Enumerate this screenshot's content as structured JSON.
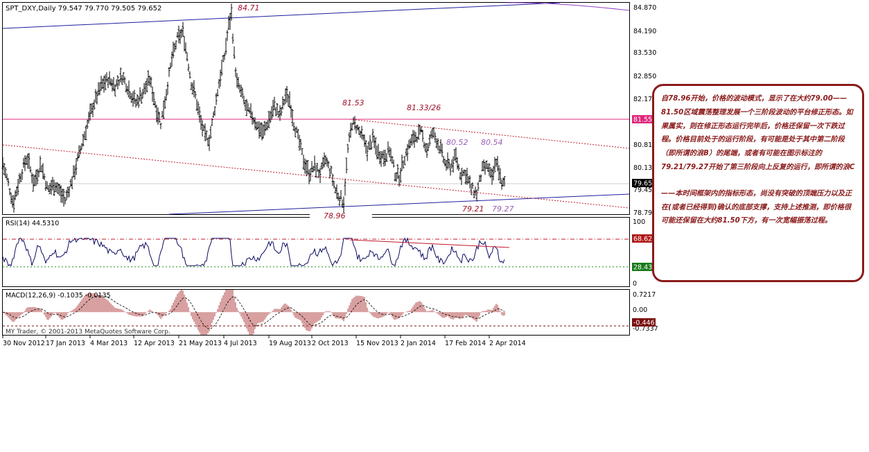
{
  "colors": {
    "background": "#ffffff",
    "frame": "#000000",
    "price_bars": "#000000",
    "channel_line": "#1e1ea0",
    "resistance_line": "#e0287c",
    "dotted_trend": "#c0182a",
    "overbought_line": "#c0182a",
    "oversold_line": "#1a8a1a",
    "annotation_text": "#a01028",
    "wave_label_text": "#9a5fb5",
    "note_border": "#8b1a1a",
    "note_text": "#8b1a1a",
    "macd_histogram": "#b04040",
    "signal_line": "#000000"
  },
  "header": {
    "symbol_info": "SPT_DXY,Daily  79.547 79.770 79.505 79.652"
  },
  "price_axis": {
    "ticks": [
      "84.870",
      "84.190",
      "83.530",
      "82.850",
      "82.170",
      "81.555",
      "80.810",
      "80.130",
      "79.652",
      "79.450",
      "78.790"
    ],
    "resistance_badge": "81.555",
    "current_badge": "79.652"
  },
  "annotations": {
    "high_label": "84.71",
    "peak_label": "81.53",
    "double_top_label": "81.33/26",
    "low_label": "78.96",
    "wave_b_left": "80.52",
    "wave_b_right": "80.54",
    "wave_low_1": "79.21",
    "wave_low_2": "79.27"
  },
  "rsi": {
    "label": "RSI(14) 44.5310",
    "axis_top": "100",
    "axis_bottom": "0",
    "upper_badge": "68.625",
    "lower_badge": "28.433"
  },
  "macd": {
    "label": "MACD(12,26,9) -0.1035 -0.0135",
    "axis_top": "0.7217",
    "axis_zero": "0.00",
    "badge": "-0.446",
    "axis_bottom": "-0.7337"
  },
  "time_axis": {
    "labels": [
      "30 Nov 2012",
      "17 Jan 2013",
      "4 Mar 2013",
      "12 Apr 2013",
      "21 May 2013",
      "4 Jul 2013",
      "19 Aug 2013",
      "2 Oct 2013",
      "15 Nov 2013",
      "2 Jan 2014",
      "17 Feb 2014",
      "2 Apr 2014"
    ]
  },
  "copyright": "MY Trader, © 2001-2013 MetaQuotes Software Corp.",
  "note": {
    "paragraph_1": "自78.96开始，价格的波动模式，显示了在大约79.00——81.50区域震荡整理发展一个三阶段波动的平台修正形态。如果属实，则在修正形态运行完毕后，价格还保留一次下跌过程。价格目前处于的运行阶段，有可能是处于其中第二阶段（即所谓的浪B）的尾端，或者有可能在图示标注的79.21/79.27开始了第三阶段向上反复的运行，即所谓的浪C",
    "paragraph_2": "——本时间框架内的指标形态，尚没有突破的顶端压力以及正在(或者已经得到)确认的底部支撑，支持上述推测，即价格很可能还保留在大约81.50下方，有一次宽幅振荡过程。"
  },
  "chart_data": {
    "type": "candlestick",
    "symbol": "SPT_DXY",
    "timeframe": "Daily",
    "ohlc_last": {
      "open": 79.547,
      "high": 79.77,
      "low": 79.505,
      "close": 79.652
    },
    "ylim": [
      78.79,
      84.87
    ],
    "x_labels": [
      "30 Nov 2012",
      "17 Jan 2013",
      "4 Mar 2013",
      "12 Apr 2013",
      "21 May 2013",
      "4 Jul 2013",
      "19 Aug 2013",
      "2 Oct 2013",
      "15 Nov 2013",
      "2 Jan 2014",
      "17 Feb 2014",
      "2 Apr 2014"
    ],
    "key_levels": [
      {
        "label": "84.71",
        "value": 84.71
      },
      {
        "label": "81.53",
        "value": 81.53
      },
      {
        "label": "81.33/26",
        "value": 81.33
      },
      {
        "label": "80.52",
        "value": 80.52
      },
      {
        "label": "80.54",
        "value": 80.54
      },
      {
        "label": "79.21",
        "value": 79.21
      },
      {
        "label": "79.27",
        "value": 79.27
      },
      {
        "label": "78.96",
        "value": 78.96
      }
    ],
    "resistance_level": 81.555,
    "price_path": [
      [
        0,
        80.2
      ],
      [
        8,
        79.6
      ],
      [
        15,
        79.0
      ],
      [
        25,
        79.8
      ],
      [
        35,
        80.4
      ],
      [
        45,
        79.6
      ],
      [
        55,
        80.2
      ],
      [
        65,
        79.4
      ],
      [
        75,
        79.6
      ],
      [
        90,
        79.1
      ],
      [
        100,
        79.7
      ],
      [
        108,
        80.3
      ],
      [
        116,
        80.9
      ],
      [
        124,
        81.5
      ],
      [
        132,
        82.0
      ],
      [
        142,
        82.5
      ],
      [
        152,
        82.7
      ],
      [
        162,
        82.5
      ],
      [
        172,
        82.8
      ],
      [
        182,
        82.4
      ],
      [
        192,
        82.0
      ],
      [
        202,
        82.3
      ],
      [
        212,
        82.7
      ],
      [
        222,
        81.8
      ],
      [
        228,
        81.4
      ],
      [
        236,
        82.3
      ],
      [
        244,
        83.3
      ],
      [
        252,
        83.9
      ],
      [
        260,
        84.1
      ],
      [
        266,
        83.4
      ],
      [
        272,
        82.6
      ],
      [
        278,
        82.2
      ],
      [
        286,
        81.4
      ],
      [
        292,
        81.0
      ],
      [
        298,
        80.9
      ],
      [
        304,
        81.6
      ],
      [
        312,
        82.6
      ],
      [
        320,
        83.4
      ],
      [
        326,
        84.3
      ],
      [
        330,
        84.65
      ],
      [
        334,
        83.4
      ],
      [
        338,
        82.6
      ],
      [
        344,
        82.3
      ],
      [
        352,
        81.8
      ],
      [
        360,
        81.6
      ],
      [
        368,
        81.3
      ],
      [
        376,
        81.1
      ],
      [
        384,
        81.5
      ],
      [
        392,
        81.9
      ],
      [
        400,
        81.6
      ],
      [
        408,
        82.2
      ],
      [
        414,
        82.1
      ],
      [
        420,
        81.4
      ],
      [
        428,
        80.8
      ],
      [
        434,
        80.3
      ],
      [
        442,
        79.9
      ],
      [
        450,
        80.1
      ],
      [
        458,
        79.9
      ],
      [
        466,
        80.3
      ],
      [
        474,
        79.9
      ],
      [
        480,
        79.4
      ],
      [
        486,
        79.2
      ],
      [
        492,
        79.05
      ],
      [
        498,
        80.6
      ],
      [
        504,
        81.4
      ],
      [
        510,
        81.3
      ],
      [
        518,
        81.0
      ],
      [
        526,
        80.6
      ],
      [
        534,
        80.9
      ],
      [
        542,
        80.5
      ],
      [
        550,
        80.4
      ],
      [
        558,
        80.6
      ],
      [
        566,
        79.9
      ],
      [
        572,
        79.8
      ],
      [
        580,
        80.4
      ],
      [
        588,
        80.8
      ],
      [
        596,
        81.0
      ],
      [
        604,
        81.1
      ],
      [
        612,
        80.6
      ],
      [
        620,
        81.1
      ],
      [
        626,
        80.9
      ],
      [
        632,
        80.6
      ],
      [
        638,
        80.2
      ],
      [
        646,
        80.1
      ],
      [
        654,
        80.4
      ],
      [
        660,
        79.9
      ],
      [
        668,
        79.9
      ],
      [
        676,
        79.45
      ],
      [
        684,
        79.3
      ],
      [
        692,
        80.0
      ],
      [
        700,
        80.1
      ],
      [
        706,
        79.7
      ],
      [
        712,
        80.3
      ],
      [
        716,
        80.0
      ],
      [
        720,
        79.5
      ],
      [
        724,
        79.65
      ]
    ],
    "rsi": {
      "value": 44.531,
      "period": 14,
      "overbought": 68.625,
      "oversold": 28.433,
      "ylim": [
        0,
        100
      ]
    },
    "macd": {
      "fast": 12,
      "slow": 26,
      "signal": 9,
      "value": -0.1035,
      "signal_value": -0.0135,
      "level": -0.446,
      "ylim": [
        -0.7337,
        0.7217
      ]
    }
  }
}
